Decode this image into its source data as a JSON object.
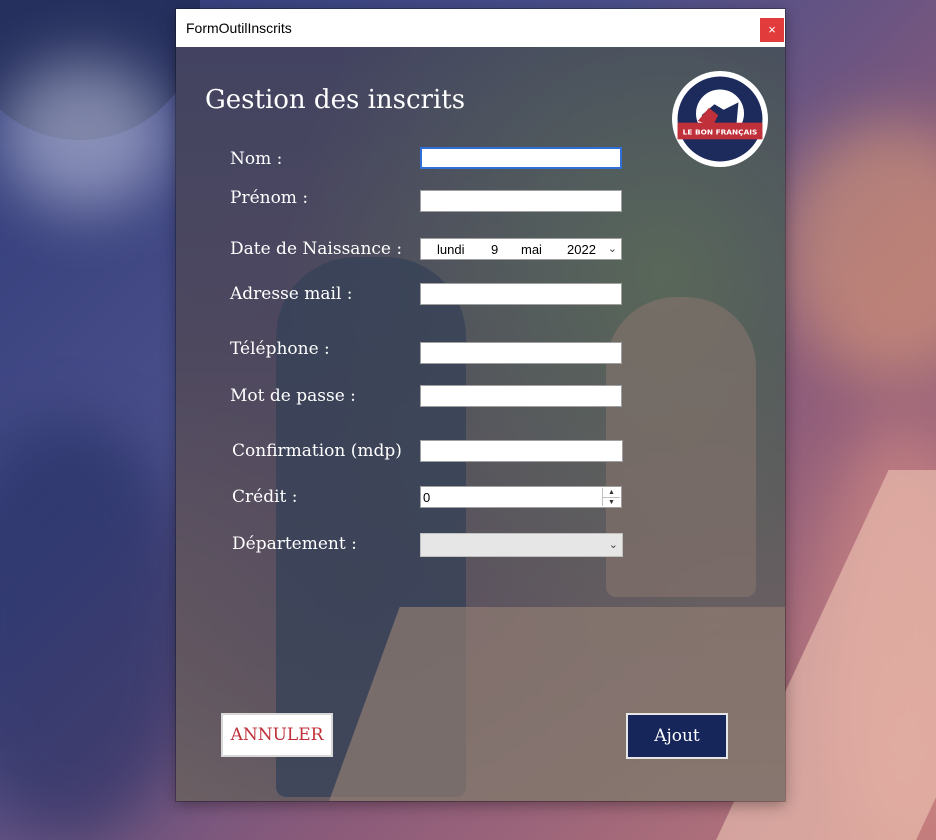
{
  "window": {
    "title": "FormOutilInscrits",
    "close_label": "×"
  },
  "form": {
    "heading": "Gestion des inscrits",
    "logo_text": "LE BON FRANÇAIS",
    "fields": {
      "nom": {
        "label": "Nom :",
        "value": ""
      },
      "prenom": {
        "label": "Prénom :",
        "value": ""
      },
      "date_naissance": {
        "label": "Date de Naissance :",
        "day_name": "lundi",
        "day": "9",
        "month": "mai",
        "year": "2022"
      },
      "email": {
        "label": "Adresse mail :",
        "value": ""
      },
      "telephone": {
        "label": "Téléphone :",
        "value": ""
      },
      "mot_de_passe": {
        "label": "Mot de passe :",
        "value": ""
      },
      "confirmation": {
        "label": "Confirmation (mdp)",
        "value": ""
      },
      "credit": {
        "label": "Crédit :",
        "value": "0"
      },
      "departement": {
        "label": "Département :",
        "value": ""
      }
    },
    "buttons": {
      "cancel": "ANNULER",
      "add": "Ajout"
    }
  },
  "colors": {
    "accent_red": "#c0303a",
    "navy": "#16265a",
    "close_red": "#e23b3b"
  },
  "icons": {
    "dropdown": "chevron-down-icon",
    "spin_up": "arrow-up-icon",
    "spin_down": "arrow-down-icon"
  }
}
